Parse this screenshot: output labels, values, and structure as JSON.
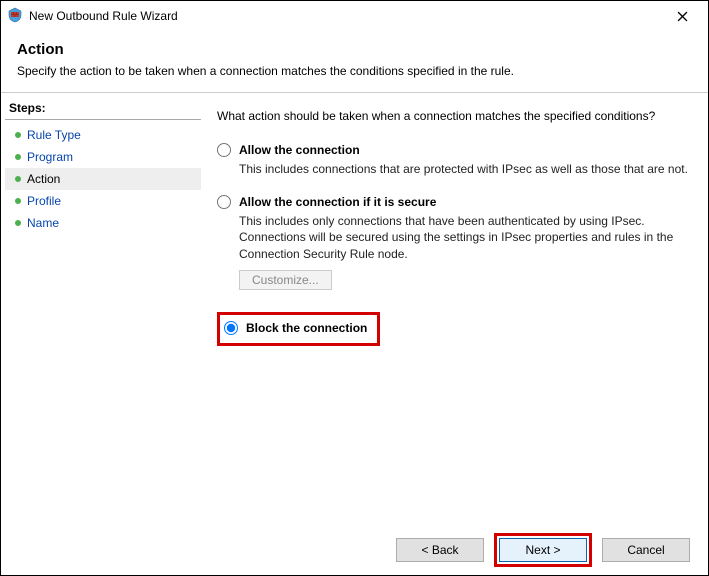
{
  "window": {
    "title": "New Outbound Rule Wizard"
  },
  "header": {
    "title": "Action",
    "description": "Specify the action to be taken when a connection matches the conditions specified in the rule."
  },
  "sidebar": {
    "title": "Steps:",
    "items": [
      {
        "label": "Rule Type",
        "active": false,
        "link": true
      },
      {
        "label": "Program",
        "active": false,
        "link": true
      },
      {
        "label": "Action",
        "active": true,
        "link": false
      },
      {
        "label": "Profile",
        "active": false,
        "link": true
      },
      {
        "label": "Name",
        "active": false,
        "link": true
      }
    ]
  },
  "content": {
    "question": "What action should be taken when a connection matches the specified conditions?",
    "options": {
      "allow": {
        "label": "Allow the connection",
        "desc": "This includes connections that are protected with IPsec as well as those that are not."
      },
      "allow_secure": {
        "label": "Allow the connection if it is secure",
        "desc": "This includes only connections that have been authenticated by using IPsec.  Connections will be secured using the settings in IPsec properties and rules in the Connection Security Rule node.",
        "customize_label": "Customize..."
      },
      "block": {
        "label": "Block the connection"
      }
    }
  },
  "footer": {
    "back": "< Back",
    "next": "Next >",
    "cancel": "Cancel"
  }
}
